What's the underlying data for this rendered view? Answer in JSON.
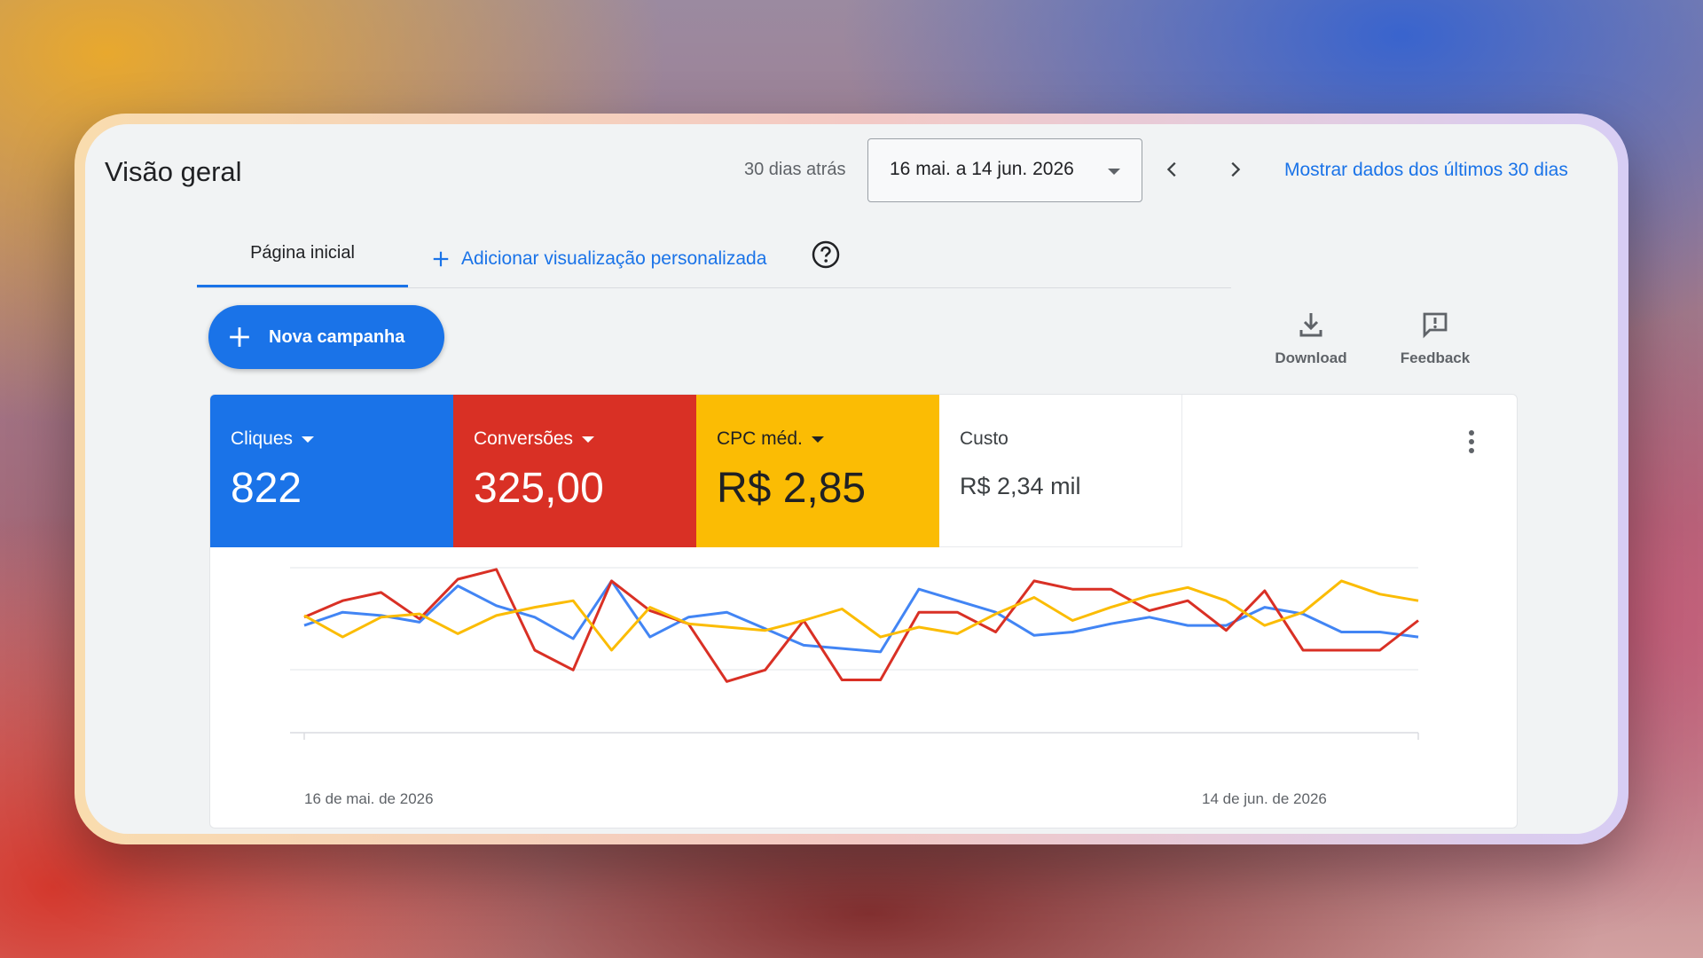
{
  "header": {
    "title": "Visão geral",
    "date_caption": "30 dias atrás",
    "date_range": "16 mai. a 14 jun. 2026",
    "show_last_30": "Mostrar dados dos últimos 30 dias"
  },
  "tabs": {
    "home": "Página inicial",
    "add_view": "Adicionar visualização personalizada"
  },
  "actions": {
    "new_campaign": "Nova campanha",
    "download": "Download",
    "feedback": "Feedback"
  },
  "metrics": [
    {
      "label": "Cliques",
      "value": "822",
      "color": "#1a73e8"
    },
    {
      "label": "Conversões",
      "value": "325,00",
      "color": "#d93025"
    },
    {
      "label": "CPC méd.",
      "value": "R$ 2,85",
      "color": "#fbbc04"
    },
    {
      "label": "Custo",
      "value": "R$ 2,34 mil",
      "color": "#ffffff"
    }
  ],
  "chart_data": {
    "type": "line",
    "x_start_label": "16 de mai. de 2026",
    "x_end_label": "14 de jun. de 2026",
    "ylim": [
      0,
      10
    ],
    "grid": true,
    "series": [
      {
        "color": "#4285f4",
        "values": [
          6.5,
          7.3,
          7.1,
          6.7,
          8.9,
          7.7,
          7.0,
          5.7,
          9.2,
          5.8,
          7.0,
          7.3,
          6.3,
          5.3,
          5.1,
          4.9,
          8.7,
          8.0,
          7.3,
          5.9,
          6.1,
          6.6,
          7.0,
          6.5,
          6.5,
          7.6,
          7.2,
          6.1,
          6.1,
          5.8
        ]
      },
      {
        "color": "#d93025",
        "values": [
          7.0,
          8.0,
          8.5,
          6.9,
          9.3,
          9.9,
          5.0,
          3.8,
          9.2,
          7.4,
          6.6,
          3.1,
          3.8,
          6.8,
          3.2,
          3.2,
          7.3,
          7.3,
          6.1,
          9.2,
          8.7,
          8.7,
          7.4,
          8.0,
          6.2,
          8.6,
          5.0,
          5.0,
          5.0,
          6.8
        ]
      },
      {
        "color": "#fbbc04",
        "values": [
          7.1,
          5.8,
          7.0,
          7.2,
          6.0,
          7.1,
          7.6,
          8.0,
          5.0,
          7.6,
          6.6,
          6.4,
          6.2,
          6.8,
          7.5,
          5.8,
          6.4,
          6.0,
          7.2,
          8.2,
          6.8,
          7.6,
          8.3,
          8.8,
          8.0,
          6.5,
          7.3,
          9.2,
          8.4,
          8.0
        ]
      }
    ]
  }
}
